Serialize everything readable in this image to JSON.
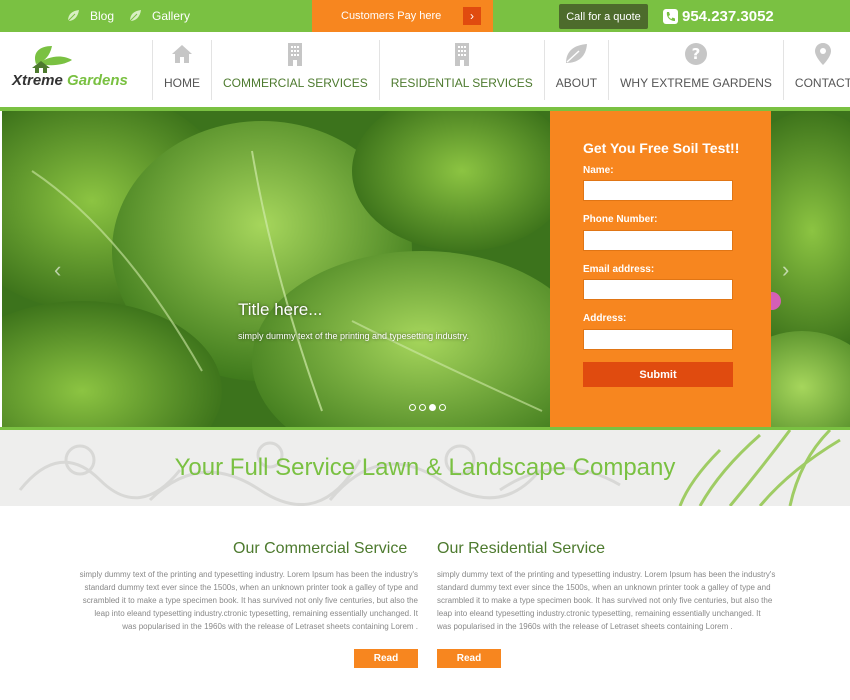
{
  "topbar": {
    "blog": "Blog",
    "gallery": "Gallery",
    "pay": "Customers Pay here",
    "pay_arrow": "›",
    "quote": "Call for a quote",
    "phone": "954.237.3052"
  },
  "logo": {
    "name_part1": "Xtreme",
    "name_part2": "Gardens"
  },
  "nav": [
    {
      "label": "HOME",
      "icon": "home-icon"
    },
    {
      "label": "COMMERCIAL SERVICES",
      "icon": "building-icon"
    },
    {
      "label": "RESIDENTIAL SERVICES",
      "icon": "building-icon"
    },
    {
      "label": "ABOUT",
      "icon": "leaf-icon"
    },
    {
      "label": "WHY EXTREME GARDENS",
      "icon": "question-icon"
    },
    {
      "label": "CONTACT",
      "icon": "location-pin-icon"
    }
  ],
  "hero": {
    "title": "Title here...",
    "text": "simply dummy text of the printing and typesetting industry.",
    "prev": "‹",
    "next": "›"
  },
  "form": {
    "title": "Get You Free Soil Test!!",
    "name_label": "Name:",
    "phone_label": "Phone Number:",
    "email_label": "Email address:",
    "address_label": "Address:",
    "submit": "Submit"
  },
  "band": {
    "title": "Your Full Service Lawn & Landscape Company"
  },
  "services": {
    "commercial": {
      "title": "Our Commercial Service",
      "body": "simply dummy text of the printing and typesetting industry. Lorem Ipsum has been the industry's standard dummy text ever since the 1500s, when an unknown printer took a galley of type and scrambled it to make a type specimen book. It has survived not only five centuries, but also the leap into eleand typesetting industry.ctronic typesetting, remaining essentially unchanged. It was popularised in the 1960s with the release of Letraset sheets containing Lorem .",
      "read": "Read"
    },
    "residential": {
      "title": "Our Residential Service",
      "body": "simply dummy text of the printing and typesetting industry. Lorem Ipsum has been the industry's standard dummy text ever since the 1500s, when an unknown printer took a galley of type and scrambled it to make a type specimen book. It has survived not only five centuries, but also the leap into eleand typesetting industry.ctronic typesetting, remaining essentially unchanged. It was popularised in the 1960s with the release of Letraset sheets containing Lorem .",
      "read": "Read"
    }
  },
  "colors": {
    "green": "#7ac142",
    "dark_green": "#4d7a2e",
    "orange": "#f7861f",
    "red_orange": "#e04b0f"
  }
}
